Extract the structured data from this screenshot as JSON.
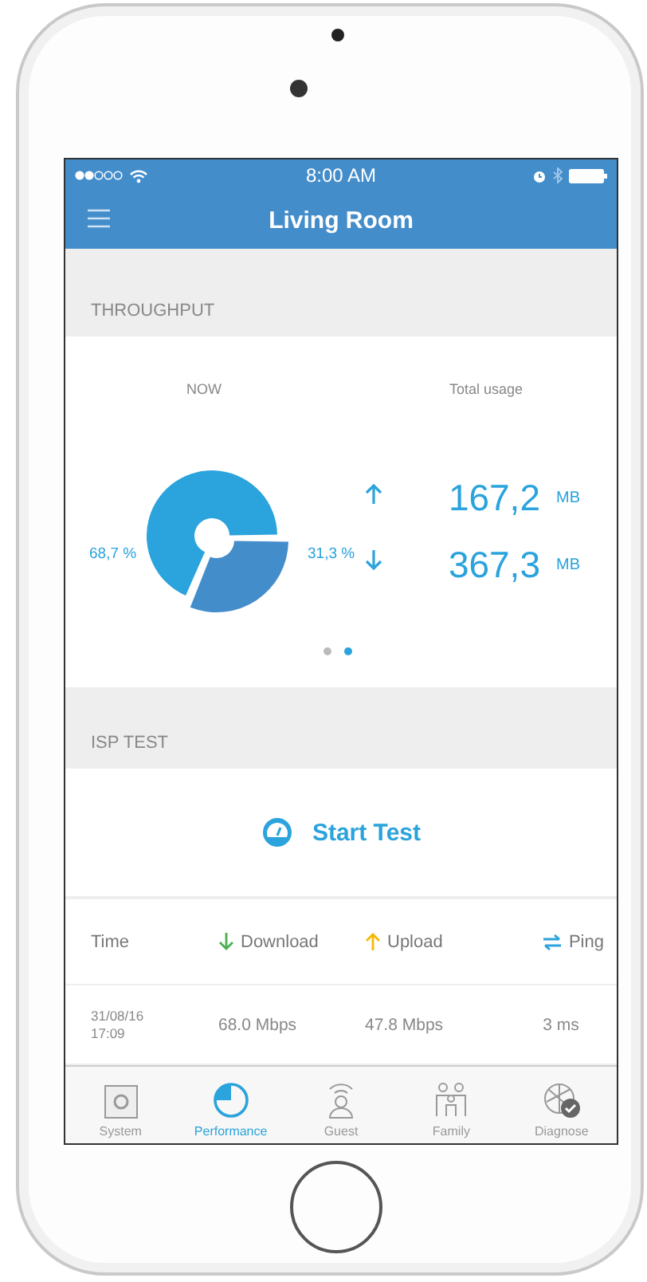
{
  "status_bar": {
    "time": "8:00 AM"
  },
  "nav": {
    "title": "Living Room"
  },
  "throughput": {
    "header": "THROUGHPUT",
    "now_label": "NOW",
    "total_label": "Total usage",
    "chart_data": {
      "type": "donut",
      "values": [
        68.7,
        31.3
      ],
      "value_labels": [
        "68,7 %",
        "31,3 %"
      ]
    },
    "usage": [
      {
        "kind": "up",
        "value": "167,2",
        "unit": "MB"
      },
      {
        "kind": "down",
        "value": "367,3",
        "unit": "MB"
      }
    ],
    "pager": [
      {
        "selected": false
      },
      {
        "selected": true
      }
    ]
  },
  "isp_test": {
    "header": "ISP TEST",
    "button": "Start Test",
    "columns": [
      {
        "kind": "time",
        "label": "Time"
      },
      {
        "kind": "download",
        "label": "Download"
      },
      {
        "kind": "upload",
        "label": "Upload"
      },
      {
        "kind": "ping",
        "label": "Ping"
      }
    ],
    "rows": [
      {
        "time": [
          "31/08/16",
          "17:09"
        ],
        "download": "68.0 Mbps",
        "upload": "47.8 Mbps",
        "ping": "3 ms"
      }
    ]
  },
  "tabs": [
    {
      "kind": "system",
      "label": "System",
      "selected": false
    },
    {
      "kind": "performance",
      "label": "Performance",
      "selected": true
    },
    {
      "kind": "guest",
      "label": "Guest",
      "selected": false
    },
    {
      "kind": "family",
      "label": "Family",
      "selected": false
    },
    {
      "kind": "diagnose",
      "label": "Diagnose",
      "selected": false
    }
  ]
}
